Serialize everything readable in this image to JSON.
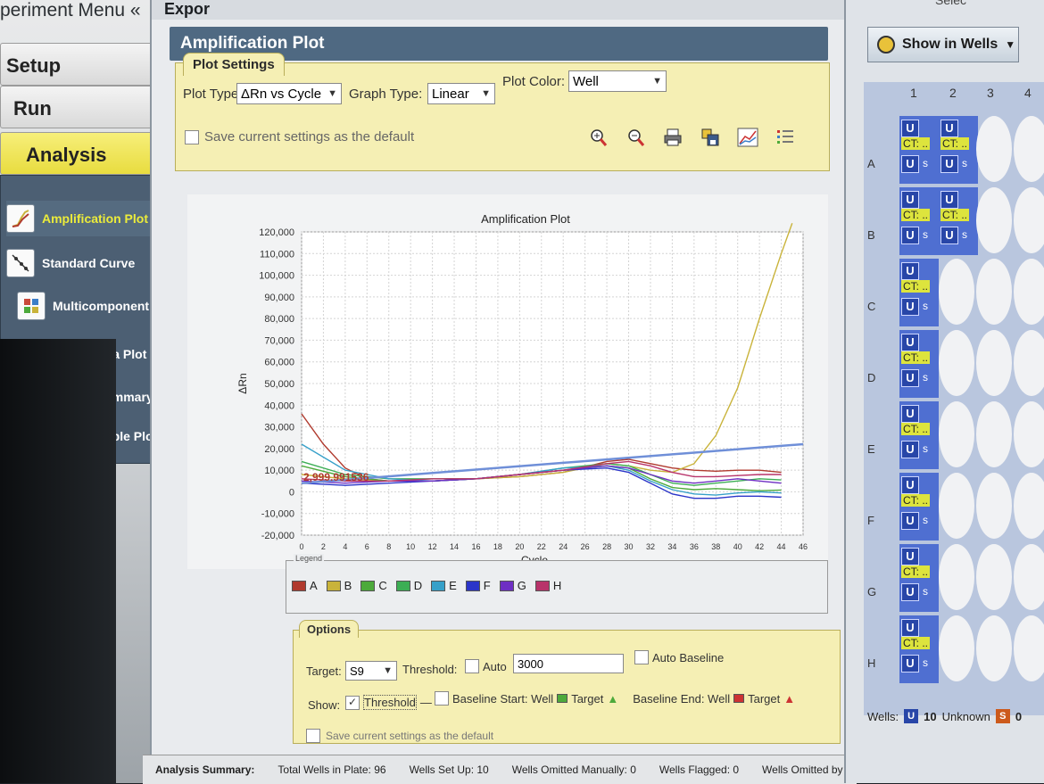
{
  "experiment_menu": {
    "title": "periment Menu «",
    "nav": [
      {
        "label": "Setup"
      },
      {
        "label": "Run"
      },
      {
        "label": "Analysis"
      }
    ],
    "analysis_items": [
      {
        "label": "Amplification Plot",
        "icon": "amplification-icon",
        "selected": true
      },
      {
        "label": "Standard Curve",
        "icon": "standard-curve-icon",
        "selected": false
      },
      {
        "label": "Multicomponent Plot",
        "icon": "multicomponent-icon",
        "selected": false
      },
      {
        "label": "Raw Data Plot",
        "icon": "raw-data-icon",
        "selected": false
      },
      {
        "label": "QC Summary",
        "icon": "qc-summary-icon",
        "selected": false
      },
      {
        "label": "Multiple Plots View",
        "icon": "multiple-plots-icon",
        "selected": false
      }
    ]
  },
  "header": {
    "top_partial": "Expor",
    "panel_title": "Amplification Plot"
  },
  "plot_settings": {
    "tab": "Plot Settings",
    "plot_type_label": "Plot Type:",
    "plot_type_value": "ΔRn vs Cycle",
    "graph_type_label": "Graph Type:",
    "graph_type_value": "Linear",
    "plot_color_label": "Plot Color:",
    "plot_color_value": "Well",
    "save_default": "Save current settings as the default",
    "toolbar": [
      "zoom-in-icon",
      "zoom-out-icon",
      "print-icon",
      "save-image-icon",
      "chart-options-icon",
      "list-icon"
    ]
  },
  "chart_data": {
    "type": "line",
    "title": "Amplification Plot",
    "xlabel": "Cycle",
    "ylabel": "ΔRn",
    "xlim": [
      0,
      46
    ],
    "ylim": [
      -20000,
      120000
    ],
    "x_ticks": [
      0,
      2,
      4,
      6,
      8,
      10,
      12,
      14,
      16,
      18,
      20,
      22,
      24,
      26,
      28,
      30,
      32,
      34,
      36,
      38,
      40,
      42,
      44,
      46
    ],
    "x_tick_labels": [
      "0",
      "2",
      "4",
      "6",
      "8",
      "10",
      "12",
      "14",
      "16",
      "18",
      "20",
      "22",
      "24",
      "26",
      "28",
      "30",
      "32",
      "34",
      "36",
      "38",
      "40",
      "42",
      "44",
      "46"
    ],
    "y_ticks": [
      -20000,
      -10000,
      0,
      10000,
      20000,
      30000,
      40000,
      50000,
      60000,
      70000,
      80000,
      90000,
      100000,
      110000,
      120000
    ],
    "y_tick_labels": [
      "-20,000",
      "-10,000",
      "0",
      "10,000",
      "20,000",
      "30,000",
      "40,000",
      "50,000",
      "60,000",
      "70,000",
      "80,000",
      "90,000",
      "100,000",
      "110,000",
      "120,000"
    ],
    "grid": true,
    "threshold_label": "2,999.991536",
    "threshold_line": {
      "x": [
        0,
        46
      ],
      "y": [
        4000,
        22000
      ],
      "color": "#6f8fd8"
    },
    "series": [
      {
        "name": "A",
        "color": "#b03a2e",
        "x": [
          0,
          2,
          4,
          6,
          8,
          12,
          16,
          20,
          24,
          28,
          30,
          32,
          34,
          36,
          38,
          40,
          42,
          44
        ],
        "y": [
          36000,
          22000,
          11000,
          6000,
          5000,
          5000,
          6000,
          7000,
          9000,
          14000,
          15000,
          13000,
          11000,
          10000,
          9500,
          10000,
          10000,
          9000
        ]
      },
      {
        "name": "B",
        "color": "#c9b33a",
        "x": [
          0,
          4,
          8,
          12,
          16,
          20,
          24,
          28,
          30,
          32,
          34,
          36,
          38,
          40,
          42,
          44,
          45
        ],
        "y": [
          8000,
          6000,
          5000,
          6000,
          6000,
          7000,
          9000,
          13000,
          12000,
          10000,
          9000,
          13000,
          26000,
          48000,
          80000,
          110000,
          124000
        ]
      },
      {
        "name": "C",
        "color": "#4daa3b",
        "x": [
          0,
          4,
          8,
          12,
          16,
          20,
          24,
          28,
          30,
          32,
          34,
          36,
          38,
          40,
          42,
          44
        ],
        "y": [
          12000,
          7000,
          5000,
          5000,
          6000,
          8000,
          10000,
          12000,
          11000,
          6000,
          2000,
          1000,
          1500,
          1000,
          500,
          800
        ]
      },
      {
        "name": "D",
        "color": "#3cae54",
        "x": [
          0,
          4,
          8,
          12,
          16,
          20,
          24,
          28,
          30,
          32,
          34,
          36,
          38,
          40,
          42,
          44
        ],
        "y": [
          14000,
          8000,
          6000,
          6000,
          6000,
          8000,
          11000,
          13000,
          12000,
          8000,
          4000,
          3000,
          4000,
          5000,
          6000,
          5500
        ]
      },
      {
        "name": "E",
        "color": "#36a0c9",
        "x": [
          0,
          4,
          8,
          12,
          16,
          20,
          24,
          28,
          30,
          32,
          34,
          36,
          38,
          40,
          42,
          44
        ],
        "y": [
          22000,
          10000,
          6000,
          5000,
          6000,
          8000,
          11000,
          12000,
          10000,
          5000,
          1000,
          -1000,
          -1500,
          -500,
          0,
          -500
        ]
      },
      {
        "name": "F",
        "color": "#2b35c9",
        "x": [
          0,
          4,
          8,
          12,
          16,
          20,
          24,
          28,
          30,
          32,
          34,
          36,
          38,
          40,
          42,
          44
        ],
        "y": [
          4000,
          3000,
          4000,
          5000,
          6000,
          8000,
          10000,
          11000,
          9000,
          4000,
          -1000,
          -3000,
          -3000,
          -2000,
          -2000,
          -2500
        ]
      },
      {
        "name": "G",
        "color": "#6e2fc3",
        "x": [
          0,
          4,
          8,
          12,
          16,
          20,
          24,
          28,
          30,
          32,
          34,
          36,
          38,
          40,
          42,
          44
        ],
        "y": [
          5000,
          4000,
          5000,
          5000,
          6000,
          8000,
          10000,
          12000,
          11000,
          8000,
          5000,
          4000,
          5000,
          6000,
          5000,
          4000
        ]
      },
      {
        "name": "H",
        "color": "#b8336a",
        "x": [
          0,
          4,
          8,
          12,
          16,
          20,
          24,
          28,
          30,
          32,
          34,
          36,
          38,
          40,
          42,
          44
        ],
        "y": [
          6000,
          5000,
          5000,
          6000,
          6000,
          8000,
          10000,
          13000,
          14000,
          12000,
          9000,
          7000,
          7000,
          7500,
          8000,
          8000
        ]
      }
    ]
  },
  "legend": {
    "caption": "Legend",
    "items": [
      {
        "label": "A",
        "color": "#b03a2e"
      },
      {
        "label": "B",
        "color": "#c9b33a"
      },
      {
        "label": "C",
        "color": "#4daa3b"
      },
      {
        "label": "D",
        "color": "#3cae54"
      },
      {
        "label": "E",
        "color": "#36a0c9"
      },
      {
        "label": "F",
        "color": "#2b35c9"
      },
      {
        "label": "G",
        "color": "#6e2fc3"
      },
      {
        "label": "H",
        "color": "#b8336a"
      }
    ]
  },
  "options": {
    "tab": "Options",
    "target_label": "Target:",
    "target_value": "S9",
    "threshold_label": "Threshold:",
    "auto_label": "Auto",
    "threshold_value": "3000",
    "auto_baseline_label": "Auto Baseline",
    "show_label": "Show:",
    "show_threshold": "Threshold",
    "baseline_start": "Baseline Start: Well",
    "target_1": "Target",
    "baseline_end": "Baseline End: Well",
    "target_2": "Target",
    "save_default": "Save current settings as the default"
  },
  "summary": {
    "label": "Analysis Summary:",
    "total_wells": "Total Wells in Plate: 96",
    "wells_setup": "Wells Set Up: 10",
    "omitted_manually": "Wells Omitted Manually: 0",
    "flagged": "Wells Flagged: 0",
    "omitted_analysis": "Wells Omitted by Analy"
  },
  "plate": {
    "top_partial": "Selec",
    "show_in_wells": "Show in Wells",
    "columns": [
      "1",
      "2",
      "3",
      "4"
    ],
    "rows": [
      "A",
      "B",
      "C",
      "D",
      "E",
      "F",
      "G",
      "H"
    ],
    "u_label": "U",
    "ct_label": "CT: ..",
    "s_label": "s",
    "footer": {
      "wells_label": "Wells:",
      "unknown_count": "10",
      "unknown_label": "Unknown",
      "standard_count": "0"
    }
  },
  "colors": {
    "accent": "#4f6982",
    "highlight": "#ecec3a",
    "panel_yellow": "#f5efb4",
    "plate_blue": "#4f6fd1"
  }
}
